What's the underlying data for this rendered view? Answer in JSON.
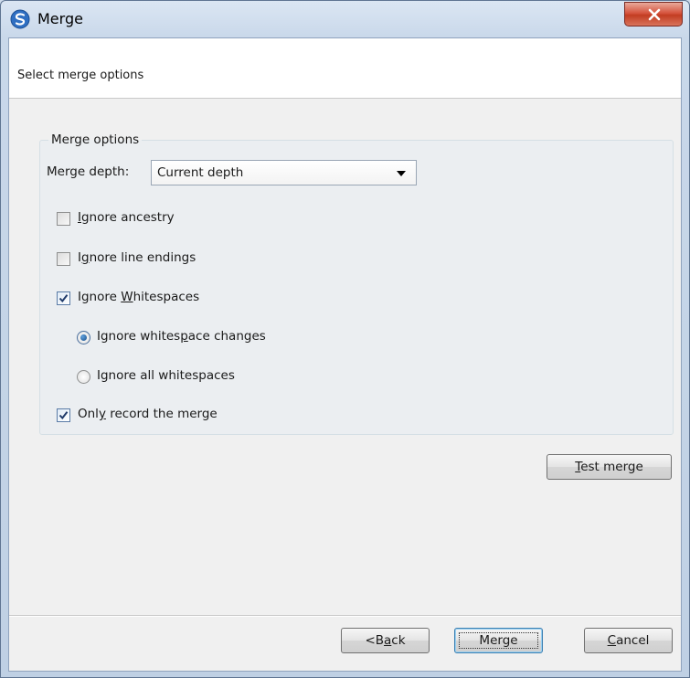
{
  "window": {
    "title": "Merge",
    "app_icon": "smartsvn-swirl-icon",
    "close_icon": "close-x-icon"
  },
  "header": {
    "text": "Select merge options"
  },
  "merge_options": {
    "legend": "Merge options",
    "depth_label": "Merge depth:",
    "depth_value": "Current depth",
    "ignore_ancestry": {
      "pre": "",
      "u": "I",
      "post": "gnore ancestry",
      "checked": false
    },
    "ignore_line_endings": {
      "pre": "I",
      "u": "g",
      "post": "nore line endings",
      "checked": false
    },
    "ignore_whitespaces": {
      "pre": "Ignore ",
      "u": "W",
      "post": "hitespaces",
      "checked": true
    },
    "ignore_whitespace_changes": {
      "pre": "Ignore whites",
      "u": "p",
      "post": "ace changes",
      "selected": true
    },
    "ignore_all_whitespaces": {
      "pre": "Ignore all whitespaces",
      "u": "",
      "post": "",
      "selected": false
    },
    "only_record": {
      "pre": "Onl",
      "u": "y",
      "post": " record the merge",
      "checked": true
    }
  },
  "buttons": {
    "test_merge": {
      "pre": "",
      "u": "T",
      "post": "est merge"
    },
    "back": {
      "pre": "<B",
      "u": "a",
      "post": "ck"
    },
    "merge": {
      "pre": "Merge",
      "u": "",
      "post": ""
    },
    "cancel": {
      "pre": "",
      "u": "C",
      "post": "ancel"
    }
  },
  "colors": {
    "accent": "#1a4e8a",
    "close_button": "#c23d22",
    "dialog_background": "#f0f0f0"
  }
}
